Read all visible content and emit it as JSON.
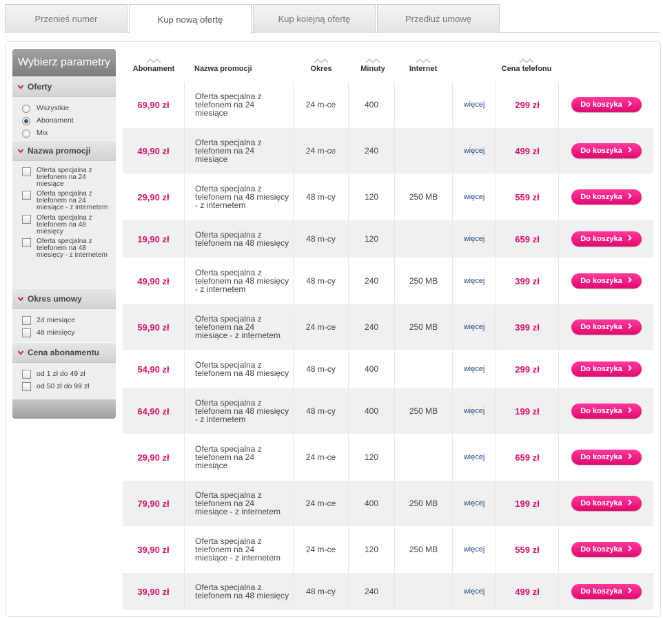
{
  "tabs": [
    {
      "label": "Przenieś numer",
      "active": false
    },
    {
      "label": "Kup nową ofertę",
      "active": true
    },
    {
      "label": "Kup kolejną ofertę",
      "active": false
    },
    {
      "label": "Przedłuż umowę",
      "active": false
    }
  ],
  "sidebar": {
    "title": "Wybierz parametry",
    "sections": [
      {
        "label": "Oferty",
        "type": "radio",
        "options": [
          {
            "label": "Wszystkie",
            "checked": false
          },
          {
            "label": "Abonament",
            "checked": true
          },
          {
            "label": "Mix",
            "checked": false
          }
        ]
      },
      {
        "label": "Nazwa promocji",
        "type": "checkbox",
        "options": [
          {
            "label": "Oferta specjalna z telefonem na 24 miesiące",
            "checked": false
          },
          {
            "label": "Oferta specjalna z telefonem na 24 miesiące - z internetem",
            "checked": false
          },
          {
            "label": "Oferta specjalna z telefonem na 48 miesięcy",
            "checked": false
          },
          {
            "label": "Oferta specjalna z telefonem na 48 miesięcy - z internetem",
            "checked": false
          }
        ]
      },
      {
        "label": "Okres umowy",
        "type": "checkbox",
        "options": [
          {
            "label": "24 miesiące",
            "checked": false
          },
          {
            "label": "48 miesięcy",
            "checked": false
          }
        ]
      },
      {
        "label": "Cena abonamentu",
        "type": "checkbox",
        "options": [
          {
            "label": "od 1 zł do 49 zł",
            "checked": false
          },
          {
            "label": "od 50 zł do 99 zł",
            "checked": false
          }
        ]
      }
    ]
  },
  "table": {
    "columns": {
      "abonament": "Abonament",
      "nazwa": "Nazwa promocji",
      "okres": "Okres",
      "minuty": "Minuty",
      "internet": "Internet",
      "cena": "Cena telefonu"
    },
    "more_label": "więcej",
    "cart_label": "Do koszyka",
    "rows": [
      {
        "abonament": "69,90 zł",
        "nazwa": [
          "Oferta specjalna z",
          "telefonem na 24",
          "miesiące"
        ],
        "okres": "24 m-ce",
        "minuty": "400",
        "internet": "",
        "cena": "299 zł"
      },
      {
        "abonament": "49,90 zł",
        "nazwa": [
          "Oferta specjalna z",
          "telefonem na 24",
          "miesiące"
        ],
        "okres": "24 m-ce",
        "minuty": "240",
        "internet": "",
        "cena": "499 zł"
      },
      {
        "abonament": "29,90 zł",
        "nazwa": [
          "Oferta specjalna z",
          "telefonem na 48 miesięcy",
          "- z internetem"
        ],
        "okres": "48 m-cy",
        "minuty": "120",
        "internet": "250 MB",
        "cena": "559 zł"
      },
      {
        "abonament": "19,90 zł",
        "nazwa": [
          "Oferta specjalna z",
          "telefonem na 48 miesięcy"
        ],
        "okres": "48 m-cy",
        "minuty": "120",
        "internet": "",
        "cena": "659 zł"
      },
      {
        "abonament": "49,90 zł",
        "nazwa": [
          "Oferta specjalna z",
          "telefonem na 48 miesięcy",
          "- z internetem"
        ],
        "okres": "48 m-cy",
        "minuty": "240",
        "internet": "250 MB",
        "cena": "399 zł"
      },
      {
        "abonament": "59,90 zł",
        "nazwa": [
          "Oferta specjalna z",
          "telefonem na 24",
          "miesiące - z internetem"
        ],
        "okres": "24 m-ce",
        "minuty": "240",
        "internet": "250 MB",
        "cena": "399 zł"
      },
      {
        "abonament": "54,90 zł",
        "nazwa": [
          "Oferta specjalna z",
          "telefonem na 48 miesięcy"
        ],
        "okres": "48 m-cy",
        "minuty": "400",
        "internet": "",
        "cena": "299 zł"
      },
      {
        "abonament": "64,90 zł",
        "nazwa": [
          "Oferta specjalna z",
          "telefonem na 48 miesięcy",
          "- z internetem"
        ],
        "okres": "48 m-cy",
        "minuty": "400",
        "internet": "250 MB",
        "cena": "199 zł"
      },
      {
        "abonament": "29,90 zł",
        "nazwa": [
          "Oferta specjalna z",
          "telefonem na 24",
          "miesiące"
        ],
        "okres": "24 m-ce",
        "minuty": "120",
        "internet": "",
        "cena": "659 zł"
      },
      {
        "abonament": "79,90 zł",
        "nazwa": [
          "Oferta specjalna z",
          "telefonem na 24",
          "miesiące - z internetem"
        ],
        "okres": "24 m-ce",
        "minuty": "400",
        "internet": "250 MB",
        "cena": "199 zł"
      },
      {
        "abonament": "39,90 zł",
        "nazwa": [
          "Oferta specjalna z",
          "telefonem na 24",
          "miesiące - z internetem"
        ],
        "okres": "24 m-ce",
        "minuty": "120",
        "internet": "250 MB",
        "cena": "559 zł"
      },
      {
        "abonament": "39,90 zł",
        "nazwa": [
          "Oferta specjalna z",
          "telefonem na 48 miesięcy"
        ],
        "okres": "48 m-cy",
        "minuty": "240",
        "internet": "",
        "cena": "499 zł"
      }
    ]
  },
  "colors": {
    "accent": "#d4136b",
    "button": "#e8107a",
    "link": "#2a4b88"
  }
}
